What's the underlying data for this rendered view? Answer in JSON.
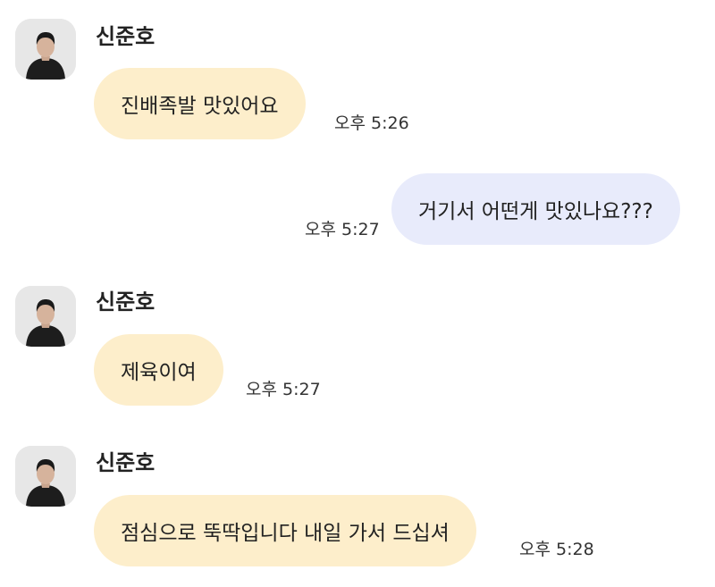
{
  "messages": [
    {
      "sender": "신준호",
      "text": "진배족발 맛있어요",
      "time": "오후 5:26",
      "direction": "incoming"
    },
    {
      "sender": "",
      "text": "거기서 어떤게 맛있나요???",
      "time": "오후 5:27",
      "direction": "outgoing"
    },
    {
      "sender": "신준호",
      "text": "제육이여",
      "time": "오후 5:27",
      "direction": "incoming"
    },
    {
      "sender": "신준호",
      "text": "점심으로 뚝딱입니다 내일 가서 드십셔",
      "time": "오후 5:28",
      "direction": "incoming"
    }
  ],
  "colors": {
    "incoming_bubble": "#fdeecb",
    "outgoing_bubble": "#e8ebfb",
    "avatar_background": "#e7e7e7"
  }
}
